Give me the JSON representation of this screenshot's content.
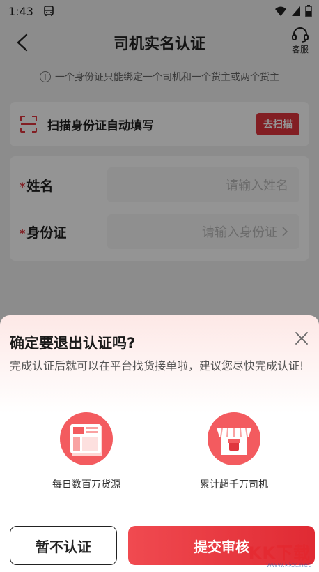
{
  "status": {
    "time": "1:43"
  },
  "header": {
    "title": "司机实名认证",
    "service_label": "客服"
  },
  "notice": "一个身份证只能绑定一个司机和一个货主或两个货主",
  "scan": {
    "text": "扫描身份证自动填写",
    "button": "去扫描"
  },
  "form": {
    "required_mark": "*",
    "name_label": "姓名",
    "name_placeholder": "请输入姓名",
    "id_label": "身份证",
    "id_placeholder": "请输入身份证"
  },
  "dialog": {
    "title": "确定要退出认证吗?",
    "description": "完成认证后就可以在平台找货接单啦，建议您尽快完成认证!",
    "features": [
      {
        "label": "每日数百万货源",
        "icon": "cargo-board-icon"
      },
      {
        "label": "累计超千万司机",
        "icon": "store-icon"
      }
    ],
    "cancel_button": "暂不认证",
    "submit_button": "提交审核"
  },
  "watermark": {
    "logo": "KK下载",
    "url": "www.kkx.net"
  },
  "colors": {
    "accent": "#e0353d",
    "overlay": "rgba(0,0,0,0.42)"
  }
}
